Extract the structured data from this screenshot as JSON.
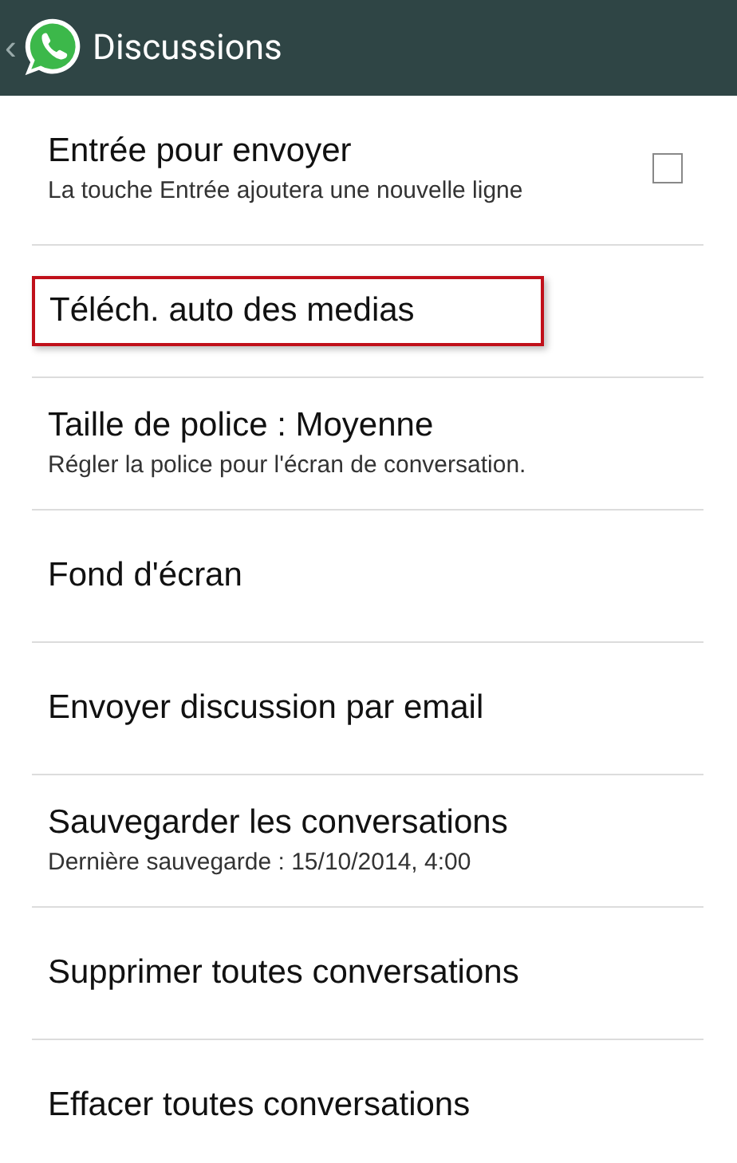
{
  "header": {
    "back": "‹",
    "title": "Discussions"
  },
  "settings": [
    {
      "kind": "checkbox",
      "title": "Entrée pour envoyer",
      "summary": "La touche Entrée ajoutera une nouvelle ligne",
      "checked": false,
      "highlighted": false
    },
    {
      "kind": "plain",
      "title": "Téléch. auto des medias",
      "highlighted": true
    },
    {
      "kind": "plain",
      "title": "Taille de police : Moyenne",
      "summary": "Régler la police pour l'écran de conversation.",
      "highlighted": false
    },
    {
      "kind": "plain",
      "title": "Fond d'écran",
      "highlighted": false
    },
    {
      "kind": "plain",
      "title": "Envoyer discussion par email",
      "highlighted": false
    },
    {
      "kind": "plain",
      "title": "Sauvegarder les conversations",
      "summary": "Dernière sauvegarde : 15/10/2014, 4:00",
      "highlighted": false
    },
    {
      "kind": "plain",
      "title": "Supprimer toutes conversations",
      "highlighted": false
    },
    {
      "kind": "plain",
      "title": "Effacer toutes conversations",
      "highlighted": false
    }
  ]
}
